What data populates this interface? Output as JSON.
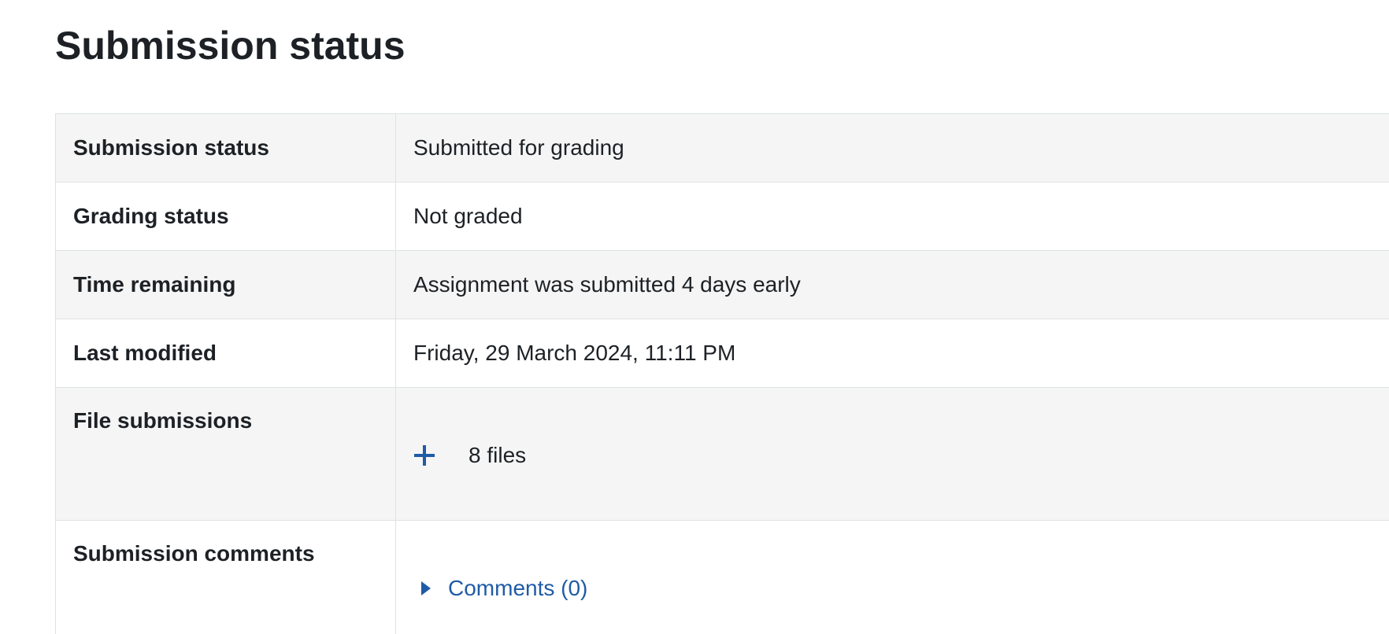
{
  "page": {
    "title": "Submission status"
  },
  "rows": [
    {
      "label": "Submission status",
      "value": "Submitted for grading",
      "highlight": "success"
    },
    {
      "label": "Grading status",
      "value": "Not graded",
      "highlight": ""
    },
    {
      "label": "Time remaining",
      "value": "Assignment was submitted 4 days early",
      "highlight": "success"
    },
    {
      "label": "Last modified",
      "value": "Friday, 29 March 2024, 11:11 PM",
      "highlight": ""
    },
    {
      "label": "File submissions",
      "files_count": "8 files",
      "expand_icon": "plus-icon"
    },
    {
      "label": "Submission comments",
      "comments_link": "Comments (0)",
      "toggle_icon": "caret-right-icon"
    }
  ],
  "colors": {
    "success_bg": "#d4eed3",
    "striped_bg": "#f5f5f5",
    "link": "#1f5ba6",
    "border": "#dee2e6"
  }
}
